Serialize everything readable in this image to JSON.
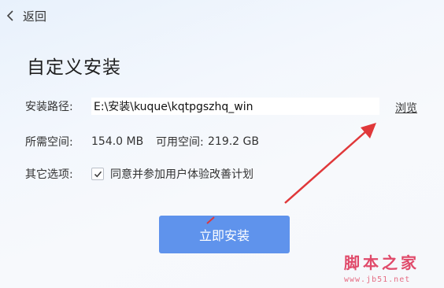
{
  "nav": {
    "back_label": "返回"
  },
  "page": {
    "title": "自定义安装"
  },
  "path": {
    "label": "安装路径:",
    "value": "E:\\安装\\kuque\\kqtpgszhq_win",
    "browse_label": "浏览"
  },
  "space": {
    "required_label": "所需空间:",
    "required_value": "154.0 MB",
    "available_label": "可用空间:",
    "available_value": "219.2 GB"
  },
  "options": {
    "label": "其它选项:",
    "checkbox_checked": true,
    "checkbox_text": "同意并参加用户体验改善计划"
  },
  "install": {
    "button_label": "立即安装",
    "accent_color": "#5f93ec"
  },
  "annotation": {
    "arrow_color": "#e0383a"
  },
  "watermark": {
    "logo": "脚本之家",
    "url": "www.jb51.net"
  }
}
